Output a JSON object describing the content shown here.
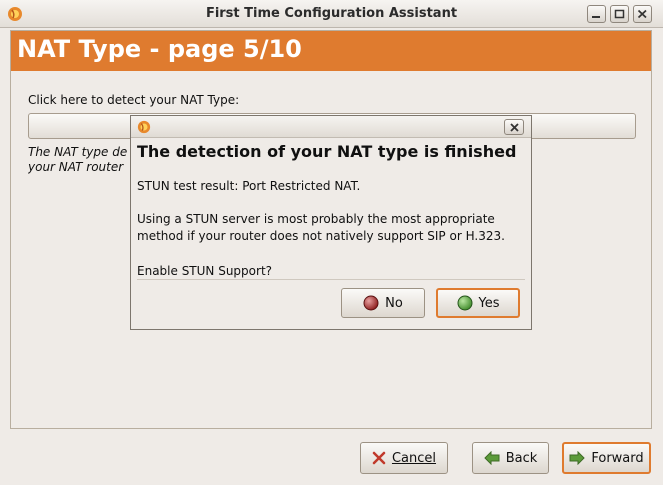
{
  "window": {
    "title": "First Time Configuration Assistant",
    "app_icon": "firefox-like-orange-icon"
  },
  "banner": {
    "title": "NAT Type - page 5/10"
  },
  "main": {
    "detect_label": "Click here to detect your NAT Type:",
    "description_line1": "The NAT type de",
    "description_line2": "your NAT router"
  },
  "buttons": {
    "cancel": {
      "label": "Cancel",
      "icon": "cancel-x-icon"
    },
    "back": {
      "label": "Back",
      "icon": "arrow-left-icon"
    },
    "forward": {
      "label": "Forward",
      "icon": "arrow-right-icon"
    }
  },
  "dialog": {
    "heading": "The detection of your NAT type is finished",
    "result": "STUN test result: Port Restricted NAT.",
    "advice": "Using a STUN server is most probably the most appropriate method if your router does not natively support SIP or H.323.",
    "enable_question": "Enable STUN Support?",
    "no_label": "No",
    "yes_label": "Yes"
  },
  "colors": {
    "accent": "#df7b2f",
    "background": "#efebe7",
    "no_icon": "#8b1a1a",
    "yes_icon": "#3f8a2a"
  }
}
